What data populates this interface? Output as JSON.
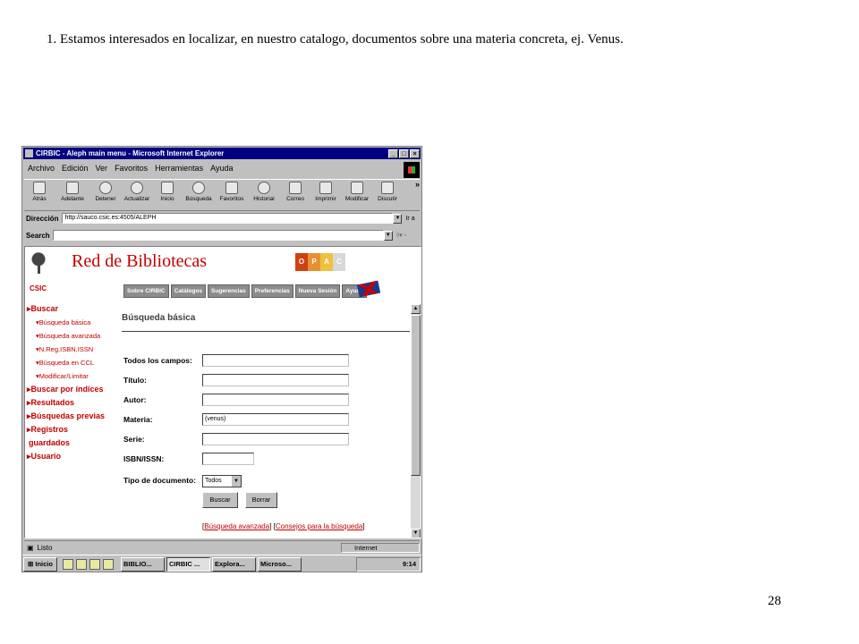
{
  "slide": {
    "caption": "1. Estamos interesados en localizar, en nuestro catalogo, documentos sobre una materia concreta,  ej. Venus.",
    "page_number": "28"
  },
  "window": {
    "title": "CIRBIC - Aleph main menu - Microsoft Internet Explorer",
    "buttons": {
      "min": "_",
      "max": "□",
      "close": "×"
    }
  },
  "menu": [
    "Archivo",
    "Edición",
    "Ver",
    "Favoritos",
    "Herramientas",
    "Ayuda"
  ],
  "toolbar": [
    {
      "label": "Atrás",
      "icon": "back-arrow-icon"
    },
    {
      "label": "Adelante",
      "icon": "forward-arrow-icon"
    },
    {
      "label": "Detener",
      "icon": "stop-icon"
    },
    {
      "label": "Actualizar",
      "icon": "refresh-icon"
    },
    {
      "label": "Inicio",
      "icon": "home-icon"
    },
    {
      "label": "Búsqueda",
      "icon": "search-icon"
    },
    {
      "label": "Favoritos",
      "icon": "favorites-icon"
    },
    {
      "label": "Historial",
      "icon": "history-icon"
    },
    {
      "label": "Correo",
      "icon": "mail-icon"
    },
    {
      "label": "Imprimir",
      "icon": "print-icon"
    },
    {
      "label": "Modificar",
      "icon": "edit-icon"
    },
    {
      "label": "Discutir",
      "icon": "discuss-icon"
    }
  ],
  "toolbar_more": "»",
  "address": {
    "label": "Dirección",
    "url": "http://sauco.csic.es:4505/ALEPH",
    "go": "Ir a"
  },
  "searchbar": {
    "label": "Search"
  },
  "site": {
    "title": "Red de Bibliotecas",
    "org": "CSIC",
    "opac": [
      {
        "letter": "O",
        "color": "#d04010"
      },
      {
        "letter": "P",
        "color": "#e89030"
      },
      {
        "letter": "A",
        "color": "#f0c040"
      },
      {
        "letter": "C",
        "color": "#d8d8d8"
      }
    ],
    "nav": [
      "Sobre CIRBIC",
      "Catálogos",
      "Sugerencias",
      "Preferencias",
      "Nueva Sesión",
      "Ayuda"
    ]
  },
  "sidenav": [
    {
      "label": "Buscar",
      "level": 1
    },
    {
      "label": "Búsqueda básica",
      "level": 2
    },
    {
      "label": "Búsqueda avanzada",
      "level": 2
    },
    {
      "label": "N.Reg,ISBN,ISSN",
      "level": 2
    },
    {
      "label": "Búsqueda en CCL",
      "level": 2
    },
    {
      "label": "Modificar/Limitar",
      "level": 2
    },
    {
      "label": "Buscar por índices",
      "level": 1
    },
    {
      "label": "Resultados",
      "level": 1
    },
    {
      "label": "Búsquedas previas",
      "level": 1
    },
    {
      "label": "Registros",
      "level": 1
    },
    {
      "label": "guardados",
      "level": 0
    },
    {
      "label": "Usuario",
      "level": 1
    }
  ],
  "form": {
    "heading": "Búsqueda básica",
    "fields": [
      {
        "label": "Todos los campos:",
        "value": ""
      },
      {
        "label": "Título:",
        "value": ""
      },
      {
        "label": "Autor:",
        "value": ""
      },
      {
        "label": "Materia:",
        "value": "(venus)"
      },
      {
        "label": "Serie:",
        "value": ""
      },
      {
        "label": "ISBN/ISSN:",
        "value": ""
      }
    ],
    "doc_type_label": "Tipo de documento:",
    "doc_type_value": "Todos",
    "search_button": "Buscar",
    "clear_button": "Borrar",
    "link_advanced": "Búsqueda avanzada",
    "link_tips": "Consejos para la búsqueda"
  },
  "status": {
    "text": "Listo",
    "zone": "Internet"
  },
  "taskbar": {
    "start": "Inicio",
    "tasks": [
      "BIBLIO...",
      "CIRBIC ...",
      "Explora...",
      "Microso..."
    ],
    "active_index": 1,
    "clock": "9:14"
  }
}
